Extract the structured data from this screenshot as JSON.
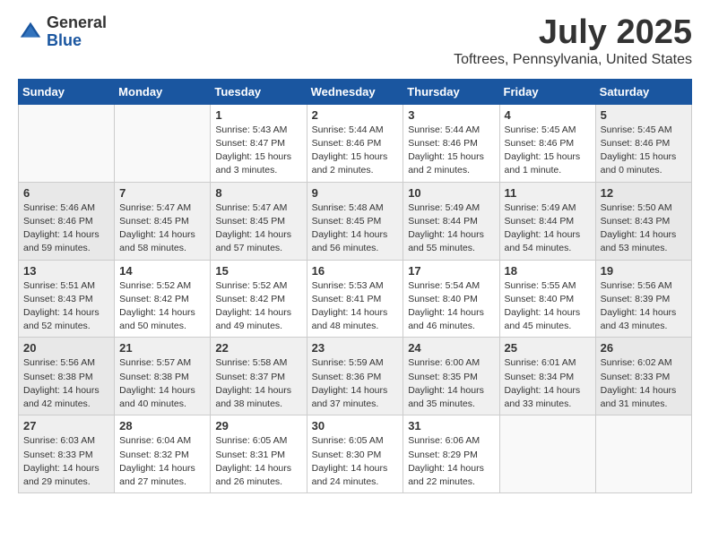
{
  "header": {
    "logo_general": "General",
    "logo_blue": "Blue",
    "month": "July 2025",
    "location": "Toftrees, Pennsylvania, United States"
  },
  "weekdays": [
    "Sunday",
    "Monday",
    "Tuesday",
    "Wednesday",
    "Thursday",
    "Friday",
    "Saturday"
  ],
  "weeks": [
    [
      {
        "day": "",
        "info": ""
      },
      {
        "day": "",
        "info": ""
      },
      {
        "day": "1",
        "info": "Sunrise: 5:43 AM\nSunset: 8:47 PM\nDaylight: 15 hours\nand 3 minutes."
      },
      {
        "day": "2",
        "info": "Sunrise: 5:44 AM\nSunset: 8:46 PM\nDaylight: 15 hours\nand 2 minutes."
      },
      {
        "day": "3",
        "info": "Sunrise: 5:44 AM\nSunset: 8:46 PM\nDaylight: 15 hours\nand 2 minutes."
      },
      {
        "day": "4",
        "info": "Sunrise: 5:45 AM\nSunset: 8:46 PM\nDaylight: 15 hours\nand 1 minute."
      },
      {
        "day": "5",
        "info": "Sunrise: 5:45 AM\nSunset: 8:46 PM\nDaylight: 15 hours\nand 0 minutes."
      }
    ],
    [
      {
        "day": "6",
        "info": "Sunrise: 5:46 AM\nSunset: 8:46 PM\nDaylight: 14 hours\nand 59 minutes."
      },
      {
        "day": "7",
        "info": "Sunrise: 5:47 AM\nSunset: 8:45 PM\nDaylight: 14 hours\nand 58 minutes."
      },
      {
        "day": "8",
        "info": "Sunrise: 5:47 AM\nSunset: 8:45 PM\nDaylight: 14 hours\nand 57 minutes."
      },
      {
        "day": "9",
        "info": "Sunrise: 5:48 AM\nSunset: 8:45 PM\nDaylight: 14 hours\nand 56 minutes."
      },
      {
        "day": "10",
        "info": "Sunrise: 5:49 AM\nSunset: 8:44 PM\nDaylight: 14 hours\nand 55 minutes."
      },
      {
        "day": "11",
        "info": "Sunrise: 5:49 AM\nSunset: 8:44 PM\nDaylight: 14 hours\nand 54 minutes."
      },
      {
        "day": "12",
        "info": "Sunrise: 5:50 AM\nSunset: 8:43 PM\nDaylight: 14 hours\nand 53 minutes."
      }
    ],
    [
      {
        "day": "13",
        "info": "Sunrise: 5:51 AM\nSunset: 8:43 PM\nDaylight: 14 hours\nand 52 minutes."
      },
      {
        "day": "14",
        "info": "Sunrise: 5:52 AM\nSunset: 8:42 PM\nDaylight: 14 hours\nand 50 minutes."
      },
      {
        "day": "15",
        "info": "Sunrise: 5:52 AM\nSunset: 8:42 PM\nDaylight: 14 hours\nand 49 minutes."
      },
      {
        "day": "16",
        "info": "Sunrise: 5:53 AM\nSunset: 8:41 PM\nDaylight: 14 hours\nand 48 minutes."
      },
      {
        "day": "17",
        "info": "Sunrise: 5:54 AM\nSunset: 8:40 PM\nDaylight: 14 hours\nand 46 minutes."
      },
      {
        "day": "18",
        "info": "Sunrise: 5:55 AM\nSunset: 8:40 PM\nDaylight: 14 hours\nand 45 minutes."
      },
      {
        "day": "19",
        "info": "Sunrise: 5:56 AM\nSunset: 8:39 PM\nDaylight: 14 hours\nand 43 minutes."
      }
    ],
    [
      {
        "day": "20",
        "info": "Sunrise: 5:56 AM\nSunset: 8:38 PM\nDaylight: 14 hours\nand 42 minutes."
      },
      {
        "day": "21",
        "info": "Sunrise: 5:57 AM\nSunset: 8:38 PM\nDaylight: 14 hours\nand 40 minutes."
      },
      {
        "day": "22",
        "info": "Sunrise: 5:58 AM\nSunset: 8:37 PM\nDaylight: 14 hours\nand 38 minutes."
      },
      {
        "day": "23",
        "info": "Sunrise: 5:59 AM\nSunset: 8:36 PM\nDaylight: 14 hours\nand 37 minutes."
      },
      {
        "day": "24",
        "info": "Sunrise: 6:00 AM\nSunset: 8:35 PM\nDaylight: 14 hours\nand 35 minutes."
      },
      {
        "day": "25",
        "info": "Sunrise: 6:01 AM\nSunset: 8:34 PM\nDaylight: 14 hours\nand 33 minutes."
      },
      {
        "day": "26",
        "info": "Sunrise: 6:02 AM\nSunset: 8:33 PM\nDaylight: 14 hours\nand 31 minutes."
      }
    ],
    [
      {
        "day": "27",
        "info": "Sunrise: 6:03 AM\nSunset: 8:33 PM\nDaylight: 14 hours\nand 29 minutes."
      },
      {
        "day": "28",
        "info": "Sunrise: 6:04 AM\nSunset: 8:32 PM\nDaylight: 14 hours\nand 27 minutes."
      },
      {
        "day": "29",
        "info": "Sunrise: 6:05 AM\nSunset: 8:31 PM\nDaylight: 14 hours\nand 26 minutes."
      },
      {
        "day": "30",
        "info": "Sunrise: 6:05 AM\nSunset: 8:30 PM\nDaylight: 14 hours\nand 24 minutes."
      },
      {
        "day": "31",
        "info": "Sunrise: 6:06 AM\nSunset: 8:29 PM\nDaylight: 14 hours\nand 22 minutes."
      },
      {
        "day": "",
        "info": ""
      },
      {
        "day": "",
        "info": ""
      }
    ]
  ]
}
